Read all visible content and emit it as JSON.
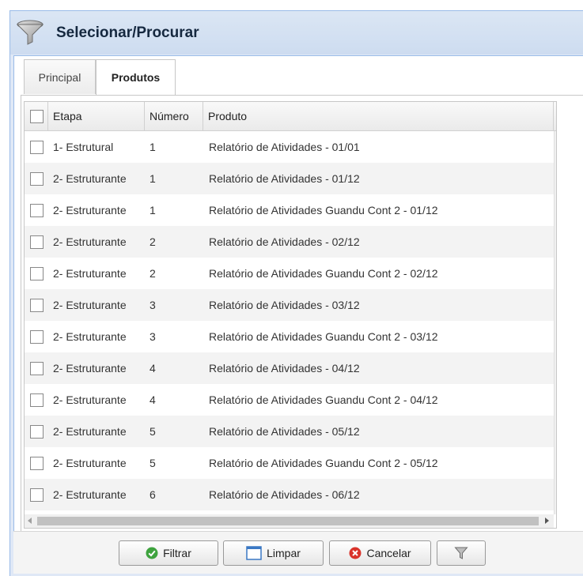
{
  "window": {
    "title": "Selecionar/Procurar"
  },
  "tabs": [
    {
      "label": "Principal",
      "active": false
    },
    {
      "label": "Produtos",
      "active": true
    }
  ],
  "grid": {
    "columns": [
      "Etapa",
      "Número",
      "Produto"
    ],
    "rows": [
      {
        "etapa": "1- Estrutural",
        "numero": "1",
        "produto": "Relatório de Atividades - 01/01"
      },
      {
        "etapa": "2- Estruturante",
        "numero": "1",
        "produto": "Relatório de Atividades - 01/12"
      },
      {
        "etapa": "2- Estruturante",
        "numero": "1",
        "produto": "Relatório de Atividades Guandu Cont 2 - 01/12"
      },
      {
        "etapa": "2- Estruturante",
        "numero": "2",
        "produto": "Relatório de Atividades - 02/12"
      },
      {
        "etapa": "2- Estruturante",
        "numero": "2",
        "produto": "Relatório de Atividades Guandu Cont 2 - 02/12"
      },
      {
        "etapa": "2- Estruturante",
        "numero": "3",
        "produto": "Relatório de Atividades - 03/12"
      },
      {
        "etapa": "2- Estruturante",
        "numero": "3",
        "produto": "Relatório de Atividades Guandu Cont 2 - 03/12"
      },
      {
        "etapa": "2- Estruturante",
        "numero": "4",
        "produto": "Relatório de Atividades - 04/12"
      },
      {
        "etapa": "2- Estruturante",
        "numero": "4",
        "produto": "Relatório de Atividades Guandu Cont 2 - 04/12"
      },
      {
        "etapa": "2- Estruturante",
        "numero": "5",
        "produto": "Relatório de Atividades - 05/12"
      },
      {
        "etapa": "2- Estruturante",
        "numero": "5",
        "produto": "Relatório de Atividades Guandu Cont 2 - 05/12"
      },
      {
        "etapa": "2- Estruturante",
        "numero": "6",
        "produto": "Relatório de Atividades - 06/12"
      }
    ]
  },
  "buttons": {
    "filtrar": {
      "label": "Filtrar",
      "icon": "check-circle-icon"
    },
    "limpar": {
      "label": "Limpar",
      "icon": "blank-page-icon"
    },
    "cancelar": {
      "label": "Cancelar",
      "icon": "cancel-circle-icon"
    },
    "funnel": {
      "icon": "funnel-icon"
    }
  },
  "colors": {
    "accent": "#99bbe8",
    "title_bg": "#dfe8f6",
    "ok_green": "#3ea33e",
    "cancel_red": "#d9332b"
  }
}
